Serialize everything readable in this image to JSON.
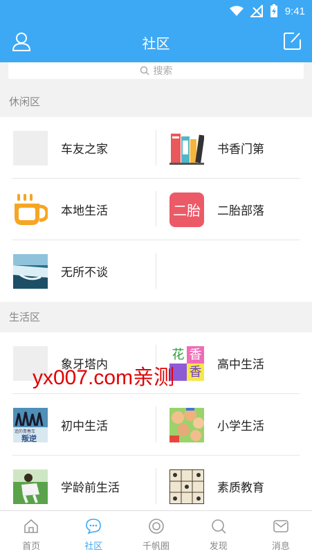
{
  "status": {
    "time": "9:41"
  },
  "header": {
    "title": "社区"
  },
  "search": {
    "placeholder": "搜索"
  },
  "sections": [
    {
      "title": "休闲区",
      "items": [
        {
          "label": "车友之家",
          "icon": "placeholder-thumb"
        },
        {
          "label": "书香门第",
          "icon": "books-icon"
        },
        {
          "label": "本地生活",
          "icon": "coffee-cup-icon"
        },
        {
          "label": "二胎部落",
          "icon": "erhai-badge-icon"
        },
        {
          "label": "无所不谈",
          "icon": "waterfall-photo"
        }
      ]
    },
    {
      "title": "生活区",
      "items": [
        {
          "label": "象牙塔内",
          "icon": "placeholder-thumb"
        },
        {
          "label": "高中生活",
          "icon": "flower-tiles-icon"
        },
        {
          "label": "初中生活",
          "icon": "dancers-photo"
        },
        {
          "label": "小学生活",
          "icon": "kids-photo"
        },
        {
          "label": "学龄前生活",
          "icon": "child-photo"
        },
        {
          "label": "素质教育",
          "icon": "grid-art-photo"
        }
      ]
    }
  ],
  "tabs": [
    {
      "label": "首页",
      "icon": "home-icon",
      "active": false
    },
    {
      "label": "社区",
      "icon": "chat-bubble-icon",
      "active": true
    },
    {
      "label": "千帆圈",
      "icon": "circle-icon",
      "active": false
    },
    {
      "label": "发现",
      "icon": "discover-search-icon",
      "active": false
    },
    {
      "label": "消息",
      "icon": "mail-icon",
      "active": false
    }
  ],
  "thumb_texts": {
    "erhai": "二胎",
    "flower_a": "花",
    "flower_b": "香",
    "flower_c": "香",
    "dancers_caption": "追的青春车",
    "dancers_word": "叛逆"
  },
  "watermark": "yx007.com亲测",
  "colors": {
    "brand": "#3da9f5",
    "background": "#f2f2f2",
    "watermark": "#e10000"
  }
}
